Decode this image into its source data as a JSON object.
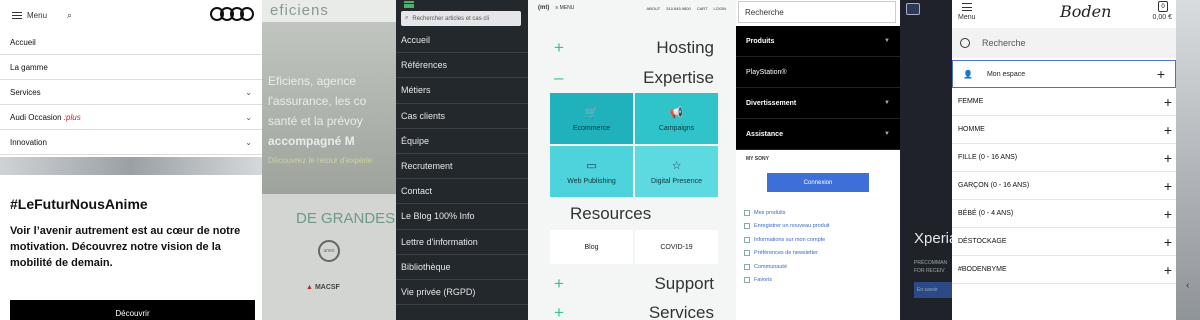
{
  "audi": {
    "menu_label": "Menu",
    "items": [
      {
        "label": "Accueil",
        "suffix": "",
        "chevron": false
      },
      {
        "label": "La gamme",
        "suffix": "",
        "chevron": false
      },
      {
        "label": "Services",
        "suffix": "",
        "chevron": true
      },
      {
        "label": "Audi Occasion",
        "suffix": ":plus",
        "chevron": true
      },
      {
        "label": "Innovation",
        "suffix": "",
        "chevron": true
      }
    ],
    "hashtag": "#LeFuturNousAnime",
    "text": "Voir l’avenir autrement est au cœur de notre motivation. Découvrez notre vision de la mobilité de demain.",
    "button_label": "Découvrir"
  },
  "eficiens": {
    "logo_text": "eficiens",
    "hero_lines": [
      "Eficiens, agence",
      "l'assurance, les co",
      "santé et la prévoy",
      "accompagné M"
    ],
    "hero_sub": "Découvrez le retour d'expérie",
    "section_title": "DE GRANDES",
    "logo1": "uneo",
    "logo2": "MACSF"
  },
  "dark_menu": {
    "search_placeholder": "Rechercher articles et cas cli",
    "items": [
      "Accueil",
      "Références",
      "Métiers",
      "Cas clients",
      "Équipe",
      "Recrutement",
      "Contact",
      "Le Blog 100% Info",
      "Lettre d'information",
      "Bibliothèque",
      "Vie privée (RGPD)"
    ]
  },
  "hosting": {
    "logo": "(mt)",
    "menu_label": "≡ MENU",
    "top_links": [
      "ABOUT",
      "310.845.9800",
      "CART",
      "LOGIN"
    ],
    "rows": [
      {
        "sign": "+",
        "label": "Hosting"
      },
      {
        "sign": "–",
        "label": "Expertise"
      }
    ],
    "tiles": [
      {
        "label": "Ecommerce",
        "icon": "cart-icon",
        "glyph": "🛒",
        "color": "#1fb2bd"
      },
      {
        "label": "Campaigns",
        "icon": "megaphone-icon",
        "glyph": "📢",
        "color": "#2ec4c9"
      },
      {
        "label": "Web Publishing",
        "icon": "browser-icon",
        "glyph": "▭",
        "color": "#4cd3db"
      },
      {
        "label": "Digital Presence",
        "icon": "star-icon",
        "glyph": "☆",
        "color": "#5cdae0"
      }
    ],
    "resources_title": "Resources",
    "resources": [
      "Blog",
      "COVID-19"
    ],
    "bottom_rows": [
      {
        "sign": "+",
        "label": "Support"
      },
      {
        "sign": "+",
        "label": "Services"
      }
    ]
  },
  "sony": {
    "search_value": "Recherche",
    "menu": [
      {
        "label": "Produits",
        "caret": true,
        "bold": true
      },
      {
        "label": "PlayStation®",
        "caret": false,
        "bold": false
      },
      {
        "label": "Divertissement",
        "caret": true,
        "bold": true
      },
      {
        "label": "Assistance",
        "caret": true,
        "bold": true
      }
    ],
    "my_sony": "MY SONY",
    "login_label": "Connexion",
    "links": [
      "Mes produits",
      "Enregistrer un nouveau produit",
      "Informations sur mon compte",
      "Préférences de newsletter",
      "Communauté",
      "Favoris"
    ]
  },
  "xperia": {
    "title": "Xperia",
    "sub_lines": [
      "PRÉCOMMAN",
      "FOR RECEIV"
    ],
    "button_label": "En savoir"
  },
  "boden": {
    "menu_label": "Menu",
    "logo": "Boden",
    "bag_count": "0",
    "price": "0,00 €",
    "search_placeholder": "Recherche",
    "account_label": "Mon espace",
    "items": [
      "FEMME",
      "HOMME",
      "FILLE (0 - 16 ANS)",
      "GARÇON (0 - 16 ANS)",
      "BÉBÉ (0 - 4 ANS)",
      "DÉSTOCKAGE",
      "#BODENBYME"
    ]
  },
  "edge": {
    "arrow": "‹"
  }
}
